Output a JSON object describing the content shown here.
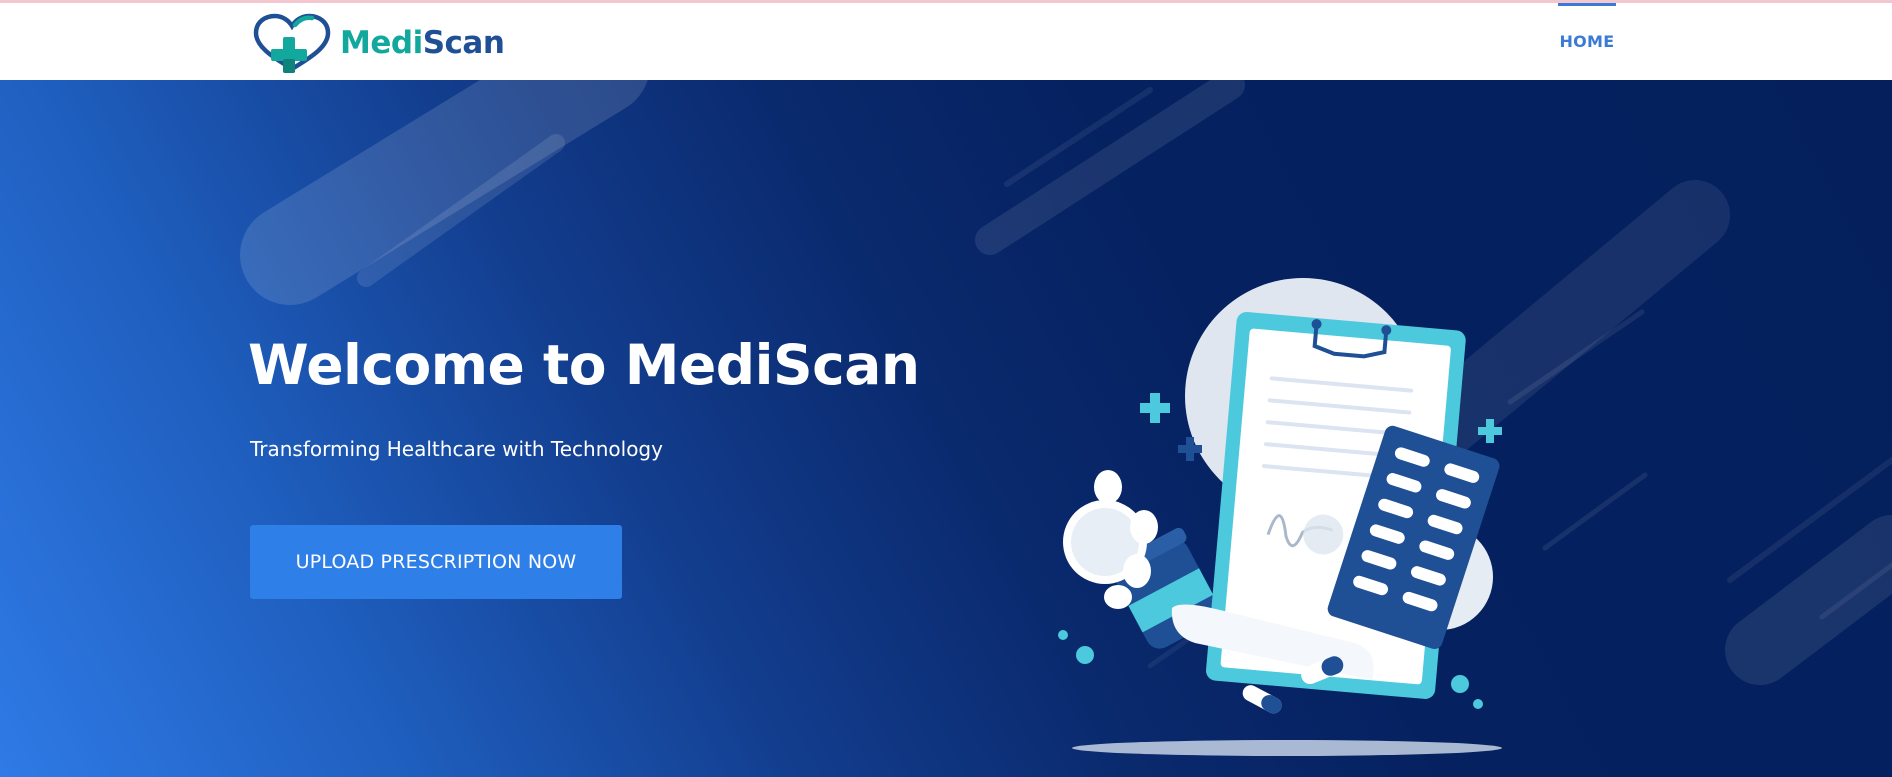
{
  "nav": {
    "brand_part1": "Medi",
    "brand_part2": "Scan",
    "home_label": "HOME"
  },
  "hero": {
    "title": "Welcome to MediScan",
    "subtitle": "Transforming Healthcare with Technology",
    "cta_label": "UPLOAD PRESCRIPTION NOW"
  },
  "colors": {
    "brand_teal": "#13a89e",
    "brand_navy": "#1f4f95",
    "accent_blue": "#3a7bd5",
    "button_blue": "#2f7fe8",
    "hero_dark": "#041f5c",
    "illustration_cyan": "#4cc9dd"
  },
  "icons": {
    "logo": "heart-with-plus-icon",
    "illustration": "prescription-clipboard-pills-illustration"
  }
}
